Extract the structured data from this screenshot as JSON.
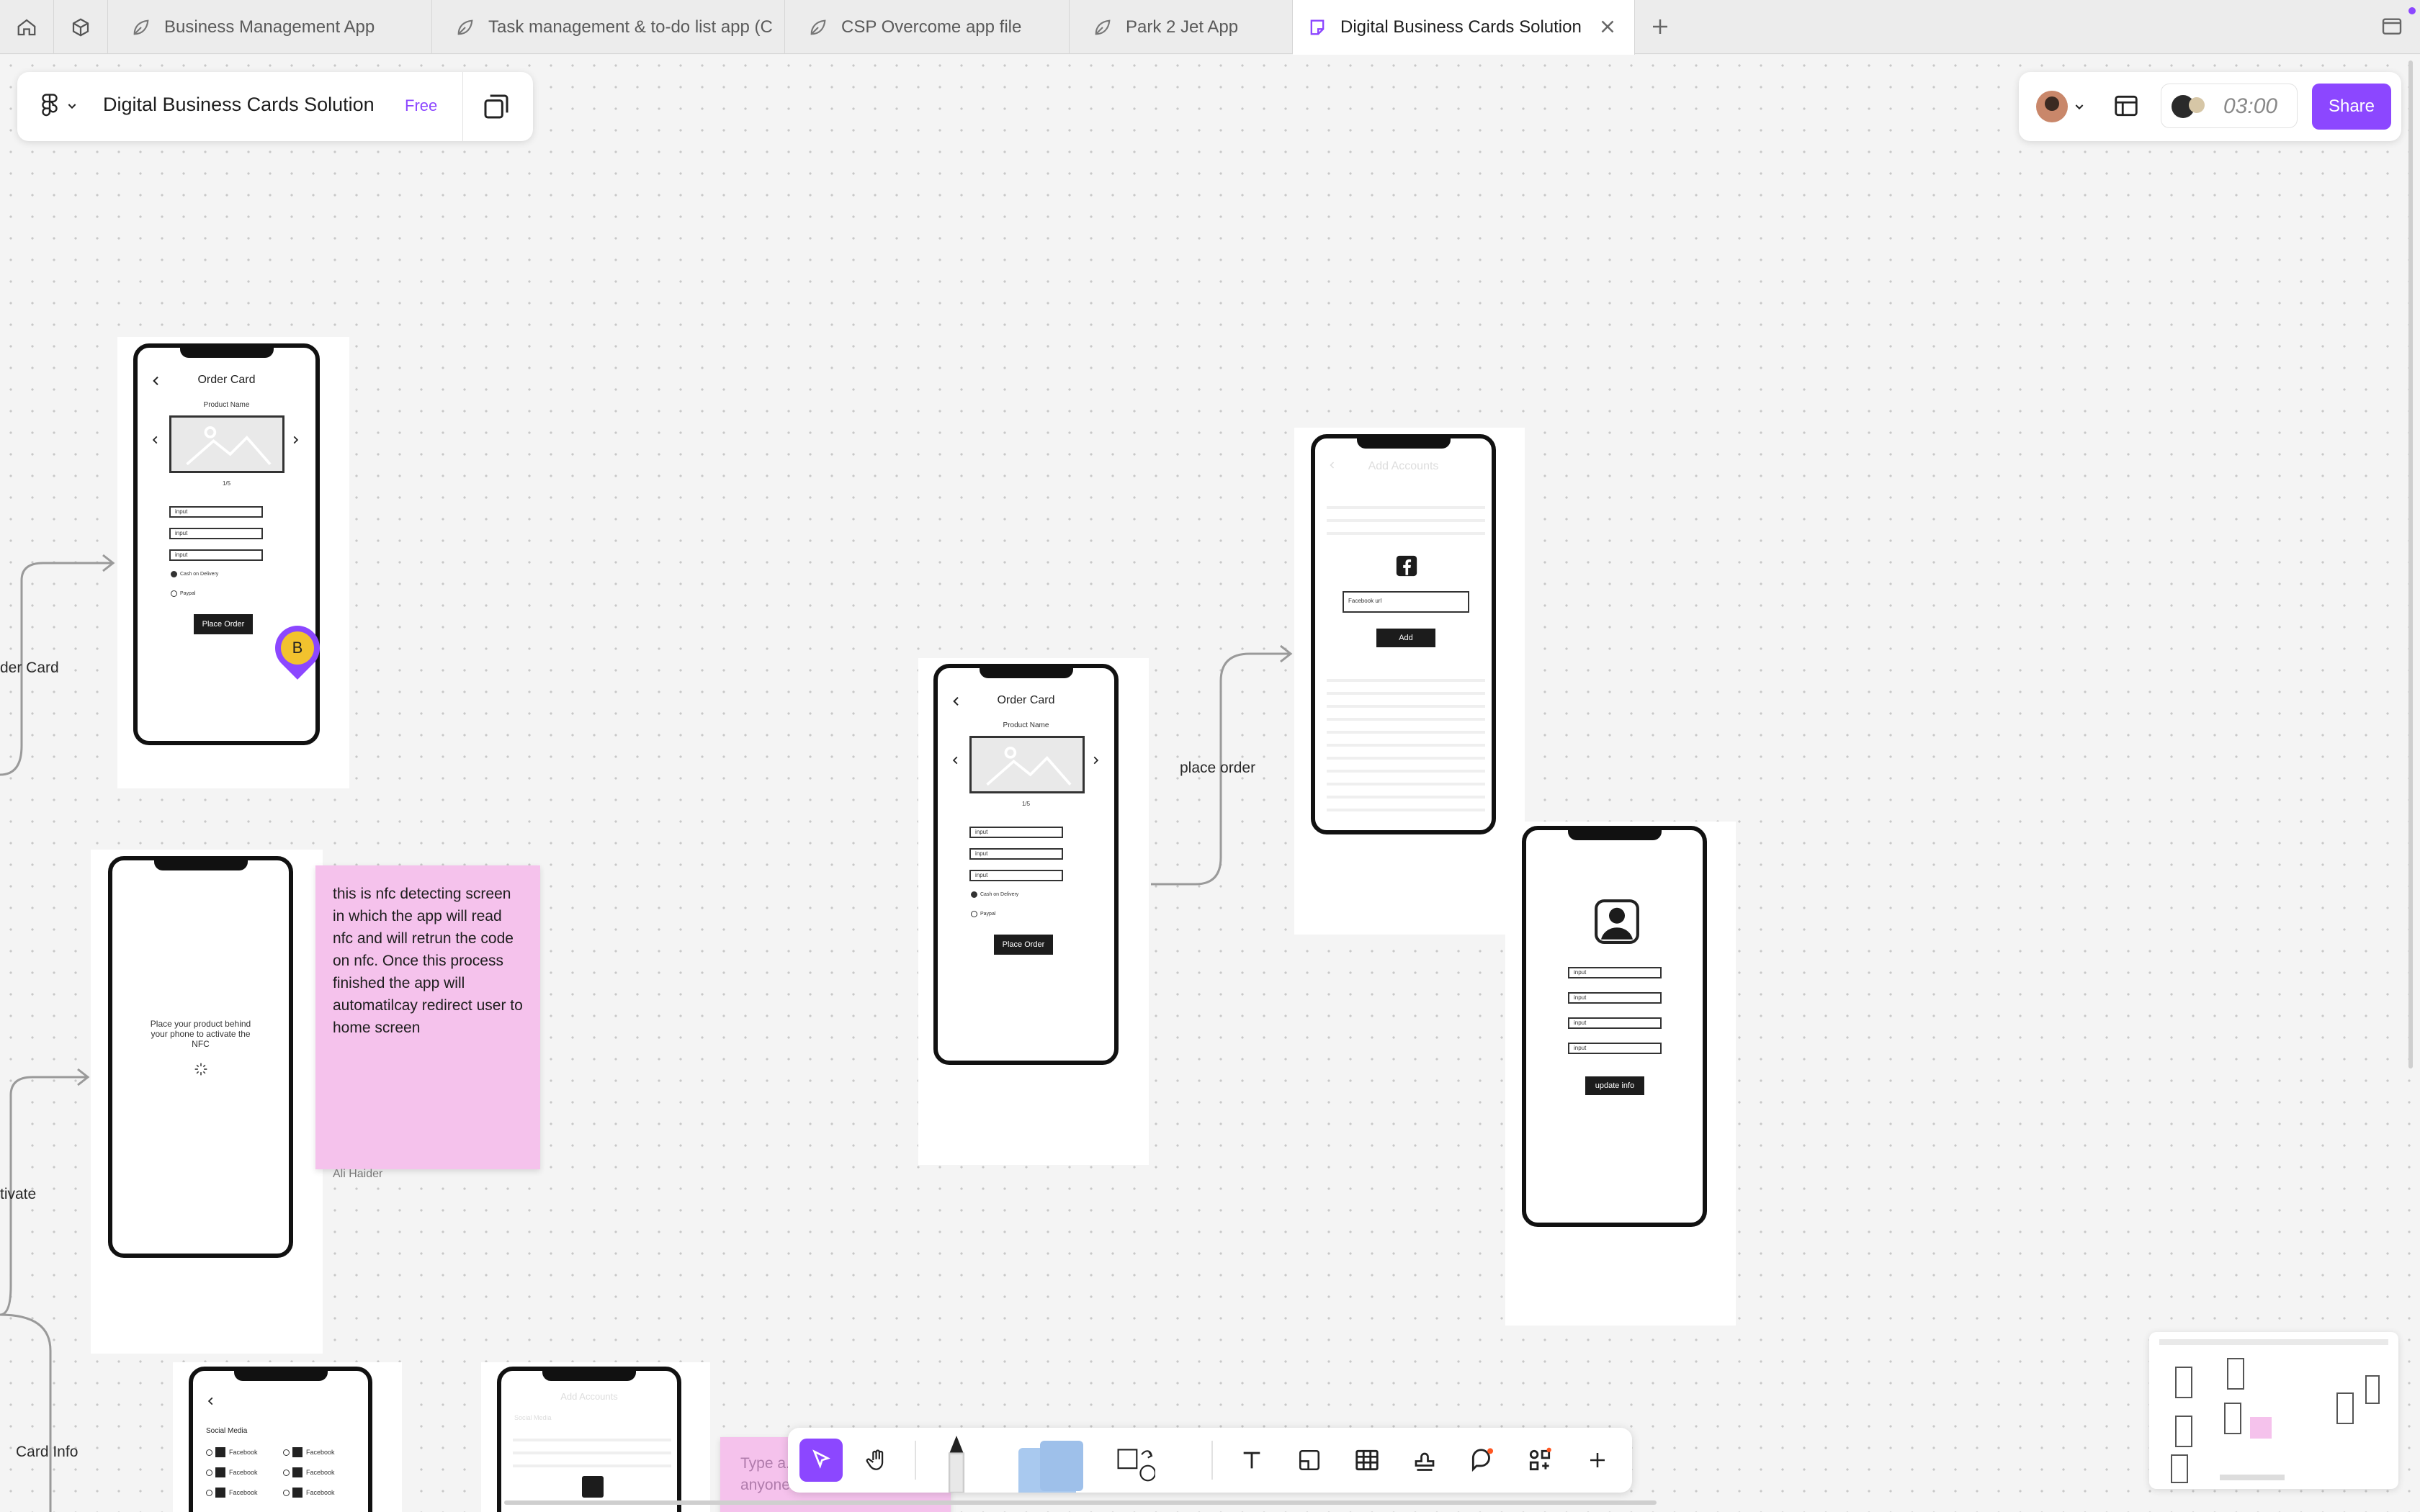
{
  "tabs": [
    {
      "label": "Business Management App"
    },
    {
      "label": "Task management & to-do list app (C"
    },
    {
      "label": "CSP Overcome app file"
    },
    {
      "label": "Park 2 Jet App"
    },
    {
      "label": "Digital Business Cards Solution",
      "active": true
    }
  ],
  "file": {
    "title": "Digital Business Cards Solution",
    "plan": "Free"
  },
  "header": {
    "timer": "03:00",
    "share_label": "Share"
  },
  "canvas": {
    "labels": {
      "order_card": "der Card",
      "activate": "tivate",
      "card_info": "Card Info",
      "place_order": "place order"
    },
    "order_card_1": {
      "title": "Order Card",
      "product": "Product Name",
      "pager": "1/5",
      "inputs": [
        "input",
        "input",
        "input"
      ],
      "radios": [
        "Cash on Delivery",
        "Paypal"
      ],
      "button": "Place Order"
    },
    "order_card_2": {
      "title": "Order Card",
      "product": "Product Name",
      "pager": "1/5",
      "inputs": [
        "input",
        "input",
        "input"
      ],
      "radios": [
        "Cash on Delivery",
        "Paypal"
      ],
      "button": "Place Order"
    },
    "add_account": {
      "title": "Add Accounts",
      "field": "Facebook url",
      "button": "Add"
    },
    "update_info": {
      "inputs": [
        "input",
        "input",
        "input",
        "input"
      ],
      "button": "update info"
    },
    "nfc": {
      "text": "Place your product behind your phone to activate the NFC"
    },
    "social": {
      "heading": "Social Media",
      "items": [
        "Facebook",
        "Facebook",
        "Facebook",
        "Facebook",
        "Facebook",
        "Facebook"
      ]
    },
    "add_accounts_2": {
      "title": "Add Accounts",
      "heading": "Social Media"
    },
    "sticky": {
      "text": "this is nfc detecting screen in which the app will read nfc and will retrun the code on nfc. Once this process finished the app will automatilcay redirect user to home screen",
      "author": "Ali Haider"
    },
    "sticky_2": {
      "placeholder": "Type a... anyone"
    },
    "cursor": {
      "initial": "B"
    }
  },
  "colors": {
    "accent": "#8c47ff",
    "sticky": "#f5c2ec",
    "free_badge": "#8c47ff"
  }
}
